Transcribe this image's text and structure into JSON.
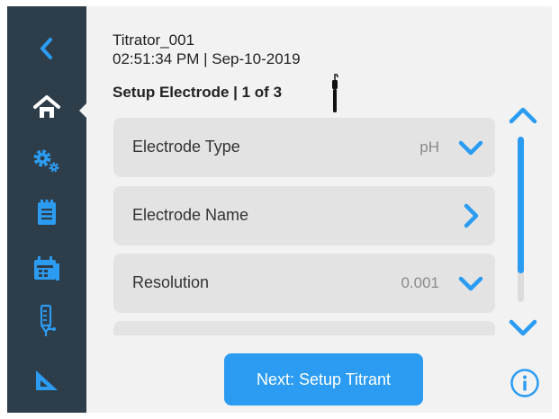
{
  "header": {
    "device_name": "Titrator_001",
    "datetime": "02:51:34 PM | Sep-10-2019",
    "step_title": "Setup Electrode | 1 of 3"
  },
  "sidebar": {
    "items": [
      {
        "icon": "back-arrow-icon"
      },
      {
        "icon": "home-icon",
        "active": true
      },
      {
        "icon": "settings-gears-icon"
      },
      {
        "icon": "clipboard-icon"
      },
      {
        "icon": "calendar-icon"
      },
      {
        "icon": "burette-icon"
      },
      {
        "icon": "triangle-ruler-icon"
      }
    ]
  },
  "settings": [
    {
      "label": "Electrode Type",
      "value": "pH",
      "control": "chevron-down"
    },
    {
      "label": "Electrode Name",
      "value": "",
      "control": "chevron-right"
    },
    {
      "label": "Resolution",
      "value": "0.001",
      "control": "chevron-down"
    }
  ],
  "scroll": {
    "position_fraction": 0.0
  },
  "next_button": {
    "label": "Next: Setup Titrant"
  },
  "colors": {
    "sidebar": "#2e3d4a",
    "accent": "#2b9cf2",
    "background": "#f2f2f2",
    "row": "#e3e3e3"
  }
}
